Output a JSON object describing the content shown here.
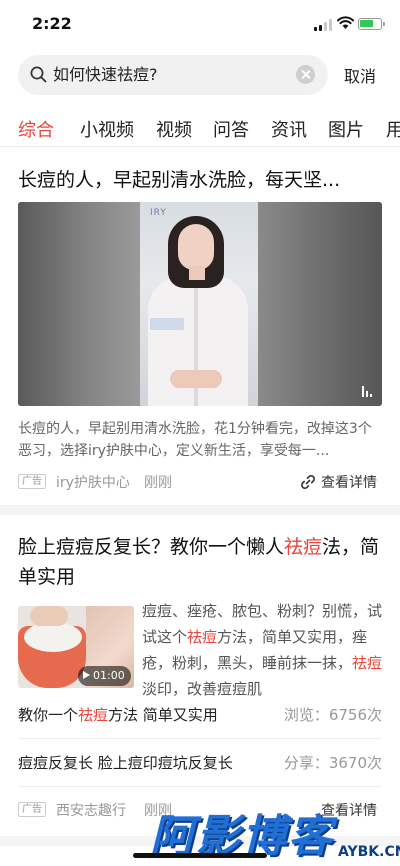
{
  "status_bar": {
    "time": "2:22"
  },
  "search": {
    "query": "如何快速祛痘?",
    "cancel_label": "取消"
  },
  "tabs": [
    {
      "label": "综合",
      "active": true
    },
    {
      "label": "小视频"
    },
    {
      "label": "视频"
    },
    {
      "label": "问答"
    },
    {
      "label": "资讯"
    },
    {
      "label": "图片"
    },
    {
      "label": "用"
    }
  ],
  "card1": {
    "title": "长痘的人，早起别清水洗脸，每天坚...",
    "video_brand_mark": "IRY",
    "description": "长痘的人，早起别用清水洗脸，花1分钟看完，改掉这3个恶习，选择iry护肤中心，定义新生活，享受每一...",
    "ad_tag": "广告",
    "source": "iry护肤中心",
    "time": "刚刚",
    "details_label": "查看详情"
  },
  "card2": {
    "title_part1": "脸上痘痘反复长？教你一个懒人",
    "title_highlight": "祛痘",
    "title_part2": "法，简单实用",
    "video_duration": "01:00",
    "desc_part1": "痘痘、痤疮、脓包、粉刺？别慌，试试这个",
    "desc_highlight1": "祛痘",
    "desc_part2": "方法，简单又实用，痤疮，粉刺，黑头，睡前抹一抹，",
    "desc_highlight2": "祛痘",
    "desc_part3": "淡印，改善痘痘肌",
    "row1_part1": "教你一个",
    "row1_highlight": "祛痘",
    "row1_part2": "方法 简单又实用",
    "row1_stat": "浏览：6756次",
    "row2_text": "痘痘反复长 脸上痘印痘坑反复长",
    "row2_stat": "分享：3670次",
    "ad_tag": "广告",
    "source": "西安志趣行",
    "time": "刚刚",
    "details_label": "查看详情"
  },
  "watermark": {
    "main": "阿影博客",
    "sub": "AYBK.CN"
  },
  "colors": {
    "accent": "#e8453c",
    "watermark": "#1f6fd6"
  }
}
